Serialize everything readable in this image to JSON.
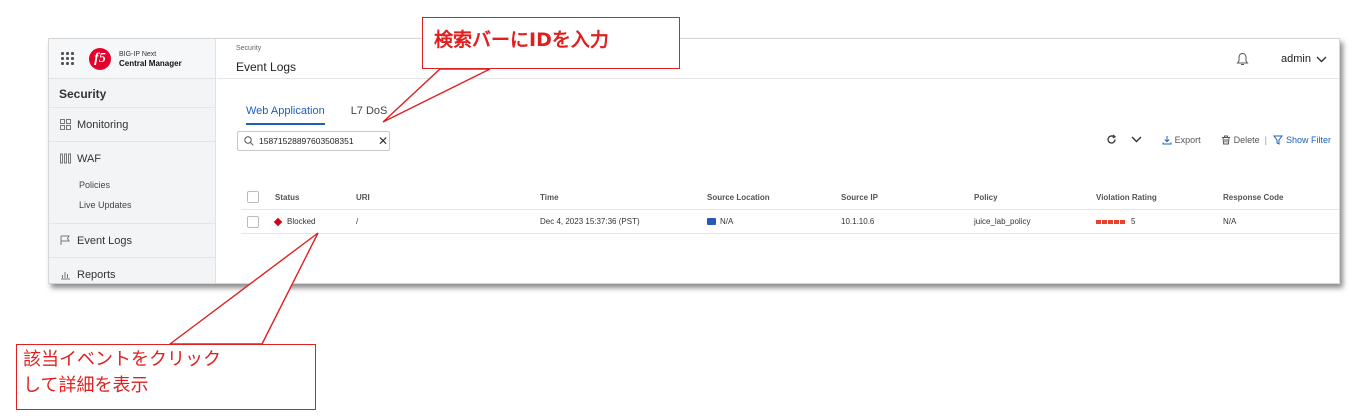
{
  "brand": {
    "line1": "BIG-IP Next",
    "line2": "Central Manager",
    "logo_text": "f5"
  },
  "sidebar": {
    "section": "Security",
    "items": [
      {
        "label": "Monitoring",
        "icon": "dashboard-icon"
      },
      {
        "label": "WAF",
        "icon": "waf-icon"
      },
      {
        "label": "Event Logs",
        "icon": "flag-icon"
      },
      {
        "label": "Reports",
        "icon": "bar-chart-icon"
      }
    ],
    "waf_subitems": [
      "Policies",
      "Live Updates"
    ]
  },
  "header": {
    "breadcrumb": "Security",
    "title": "Event Logs",
    "user": "admin"
  },
  "tabs": [
    {
      "label": "Web Application",
      "active": true
    },
    {
      "label": "L7 DoS",
      "active": false
    }
  ],
  "search": {
    "value": "15871528897603508351"
  },
  "toolbar": {
    "export_label": "Export",
    "delete_label": "Delete",
    "separator": "|",
    "show_filter_label": "Show Filter"
  },
  "table": {
    "columns": [
      "Status",
      "URI",
      "Time",
      "Source Location",
      "Source IP",
      "Policy",
      "Violation Rating",
      "Response Code"
    ],
    "rows": [
      {
        "status": "Blocked",
        "uri": "/",
        "time": "Dec 4, 2023 15:37:36 (PST)",
        "source_location": "N/A",
        "source_ip": "10.1.10.6",
        "policy": "juice_lab_policy",
        "violation_rating": "5",
        "response_code": "N/A"
      }
    ]
  },
  "annotations": {
    "search_callout": "検索バーにIDを入力",
    "click_callout_line1": "該当イベントをクリック",
    "click_callout_line2": "して詳細を表示"
  },
  "colors": {
    "accent": "#1f5fb8",
    "blocked": "#d0021b",
    "rating": "#e8432e",
    "annotation": "#e02020"
  }
}
